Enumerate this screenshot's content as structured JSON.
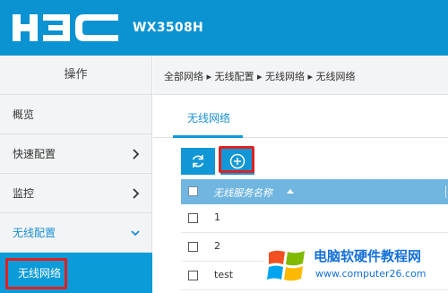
{
  "header": {
    "brand": "H3C",
    "model": "WX3508H",
    "colors": {
      "bar": "#0b93d1",
      "accent": "#0a9bd8",
      "highlight": "#e02020"
    }
  },
  "sidebar": {
    "title": "操作",
    "items": [
      {
        "label": "概览",
        "icon": "none"
      },
      {
        "label": "快速配置",
        "icon": "chevron-right-icon"
      },
      {
        "label": "监控",
        "icon": "chevron-right-icon"
      },
      {
        "label": "无线配置",
        "icon": "chevron-down-icon"
      }
    ],
    "active_sub": "无线网络"
  },
  "main": {
    "breadcrumb": "全部网络 ▸ 无线配置 ▸ 无线网络 ▸ 无线网络",
    "tab": "无线网络",
    "toolbar": {
      "refresh_icon": "refresh-icon",
      "add_icon": "add-circle-icon"
    },
    "table": {
      "header": "无线服务名称",
      "rows": [
        {
          "name": "1"
        },
        {
          "name": "2"
        },
        {
          "name": "test"
        }
      ]
    }
  },
  "watermark": {
    "title": "电脑软硬件教程网",
    "url": "www.computer26.com"
  }
}
